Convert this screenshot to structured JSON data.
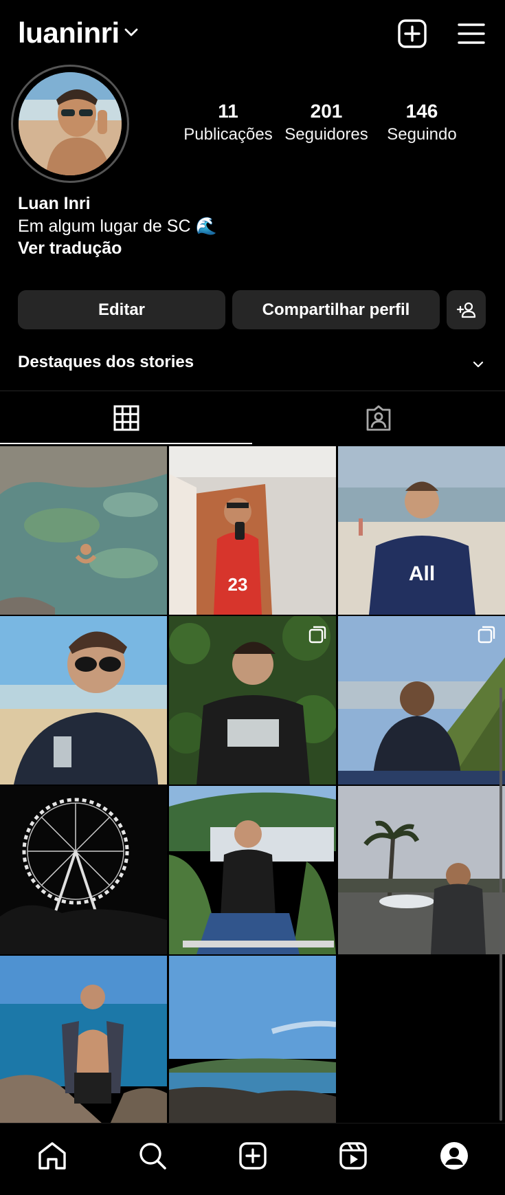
{
  "header": {
    "username": "luaninri",
    "icons": [
      "chevron-down-icon",
      "new-post-icon",
      "menu-icon"
    ]
  },
  "profile": {
    "stats": [
      {
        "value": "11",
        "label": "Publicações"
      },
      {
        "value": "201",
        "label": "Seguidores"
      },
      {
        "value": "146",
        "label": "Seguindo"
      }
    ],
    "name": "Luan Inri",
    "bio": "Em algum lugar de SC 🌊",
    "translate": "Ver tradução"
  },
  "actions": {
    "edit": "Editar",
    "share": "Compartilhar perfil",
    "add_icon": "add-person-icon"
  },
  "highlights": {
    "label": "Destaques dos stories"
  },
  "tabs": [
    {
      "icon": "grid-icon",
      "active": true
    },
    {
      "icon": "tagged-icon",
      "active": false
    }
  ],
  "posts": [
    {
      "scene": "rock pool",
      "multi": false
    },
    {
      "scene": "bathroom selfie",
      "multi": false
    },
    {
      "scene": "beach",
      "multi": false
    },
    {
      "scene": "beach smile",
      "multi": false
    },
    {
      "scene": "ivy wall",
      "multi": true
    },
    {
      "scene": "mountain",
      "multi": true
    },
    {
      "scene": "ferris wheel",
      "multi": false
    },
    {
      "scene": "marina",
      "multi": false
    },
    {
      "scene": "palm fountain",
      "multi": false
    },
    {
      "scene": "sea rocks",
      "multi": false
    },
    {
      "scene": "coast sky",
      "multi": false
    }
  ],
  "bottom_nav": [
    "home-icon",
    "search-icon",
    "create-icon",
    "reels-icon",
    "profile-icon"
  ],
  "colors": {
    "background": "#000000",
    "button": "#262626",
    "text": "#ffffff"
  }
}
